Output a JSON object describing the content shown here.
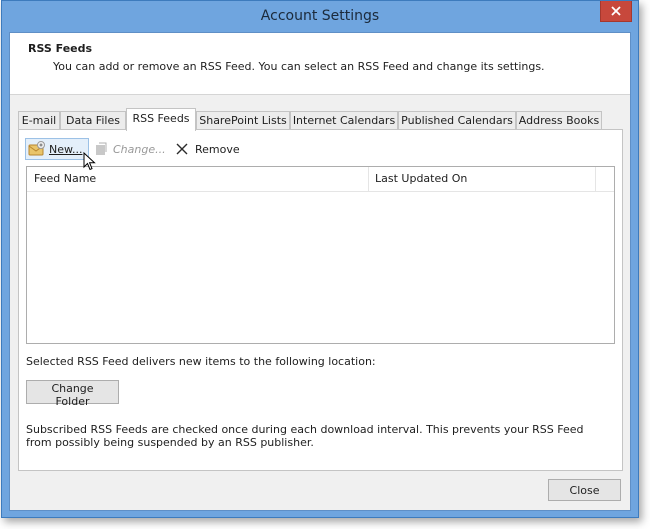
{
  "window": {
    "title": "Account Settings"
  },
  "header": {
    "title": "RSS Feeds",
    "description": "You can add or remove an RSS Feed. You can select an RSS Feed and change its settings."
  },
  "tabs": [
    {
      "label": "E-mail"
    },
    {
      "label": "Data Files"
    },
    {
      "label": "RSS Feeds",
      "active": true
    },
    {
      "label": "SharePoint Lists"
    },
    {
      "label": "Internet Calendars"
    },
    {
      "label": "Published Calendars"
    },
    {
      "label": "Address Books"
    }
  ],
  "toolbar": {
    "new_label": "New...",
    "change_label": "Change...",
    "remove_label": "Remove"
  },
  "feeds_table": {
    "columns": [
      "Feed Name",
      "Last Updated On"
    ],
    "rows": []
  },
  "location_label": "Selected RSS Feed delivers new items to the following location:",
  "change_folder_label": "Change Folder",
  "note": "Subscribed RSS Feeds are checked once during each download interval. This prevents your RSS Feed from possibly being suspended by an RSS publisher.",
  "close_label": "Close",
  "colors": {
    "window_frame": "#6fa5df",
    "close_button": "#c7483c",
    "hover_highlight": "#e4effa"
  }
}
